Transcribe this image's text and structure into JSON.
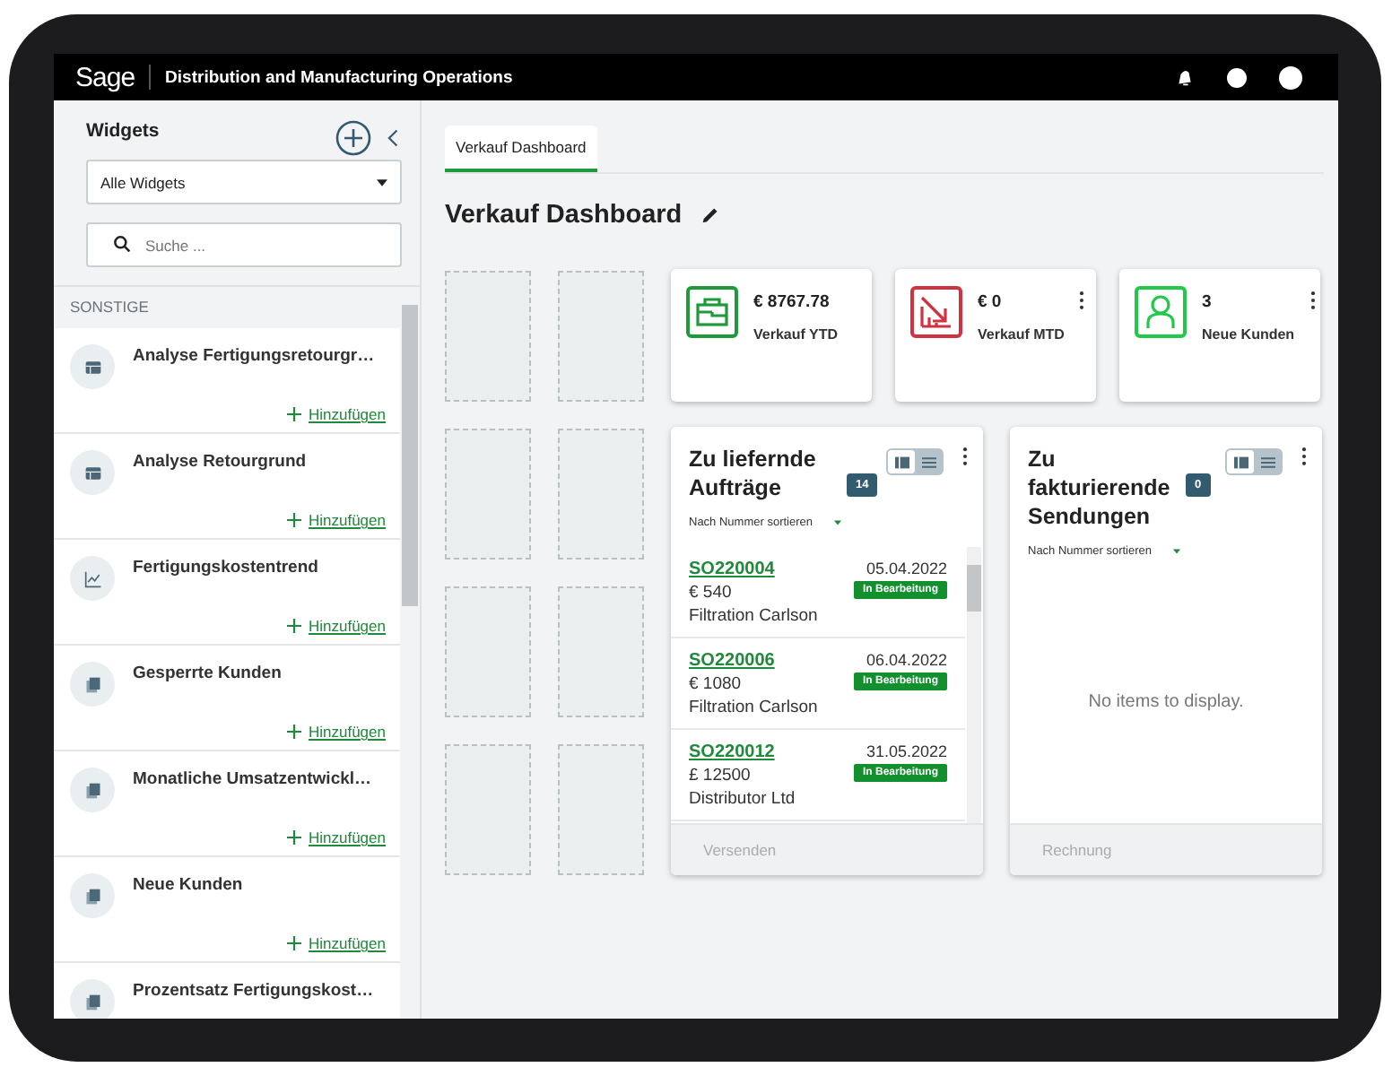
{
  "top_bar": {
    "logo": "Sage",
    "title": "Distribution and Manufacturing Operations"
  },
  "sidebar": {
    "title": "Widgets",
    "filter": {
      "value": "Alle Widgets"
    },
    "search": {
      "placeholder": "Suche ..."
    },
    "section": "SONSTIGE",
    "items": [
      {
        "kind": "table",
        "name": "Analyse Fertigungsretourgr…",
        "action": "Hinzufügen"
      },
      {
        "kind": "table",
        "name": "Analyse Retourgrund",
        "action": "Hinzufügen"
      },
      {
        "kind": "chart",
        "name": "Fertigungskostentrend",
        "action": "Hinzufügen"
      },
      {
        "kind": "pages",
        "name": "Gesperrte Kunden",
        "action": "Hinzufügen"
      },
      {
        "kind": "pages",
        "name": "Monatliche Umsatzentwickl…",
        "action": "Hinzufügen"
      },
      {
        "kind": "pages",
        "name": "Neue Kunden",
        "action": "Hinzufügen"
      },
      {
        "kind": "pages",
        "name": "Prozentsatz Fertigungskost…"
      }
    ]
  },
  "tabs": [
    {
      "label": "Verkauf Dashboard",
      "selected": true
    }
  ],
  "title": "Verkauf Dashboard",
  "kpis": [
    {
      "kind": "briefcase",
      "color": "#1f9a3a",
      "value": "€ 8767.78",
      "label": "Verkauf YTD",
      "menu": false
    },
    {
      "kind": "chart-down",
      "color": "#d2323f",
      "value": "€ 0",
      "label": "Verkauf MTD",
      "menu": true
    },
    {
      "kind": "person",
      "color": "#22c84a",
      "value": "3",
      "label": "Neue Kunden",
      "menu": true
    }
  ],
  "lists": [
    {
      "title": "Zu liefernde Aufträge",
      "count": "14",
      "views": [
        {
          "kind": "cards",
          "selected": true
        },
        {
          "kind": "rows",
          "selected": false
        }
      ],
      "sort": "Nach Nummer sortieren",
      "rows": [
        {
          "number": "SO220004",
          "amount": "€ 540",
          "customer": "Filtration Carlson",
          "date": "05.04.2022",
          "status": "In Bearbeitung"
        },
        {
          "number": "SO220006",
          "amount": "€ 1080",
          "customer": "Filtration Carlson",
          "date": "06.04.2022",
          "status": "In Bearbeitung"
        },
        {
          "number": "SO220012",
          "amount": "£ 12500",
          "customer": "Distributor Ltd",
          "date": "31.05.2022",
          "status": "In Bearbeitung"
        }
      ],
      "footer": {
        "label": "Versenden",
        "disabled": true
      }
    },
    {
      "title": "Zu fakturierende Sendungen",
      "count": "0",
      "views": [
        {
          "kind": "cards",
          "selected": true
        },
        {
          "kind": "rows",
          "selected": false
        }
      ],
      "sort": "Nach Nummer sortieren",
      "empty": "No items to display.",
      "footer": {
        "label": "Rechnung",
        "disabled": true
      }
    }
  ]
}
